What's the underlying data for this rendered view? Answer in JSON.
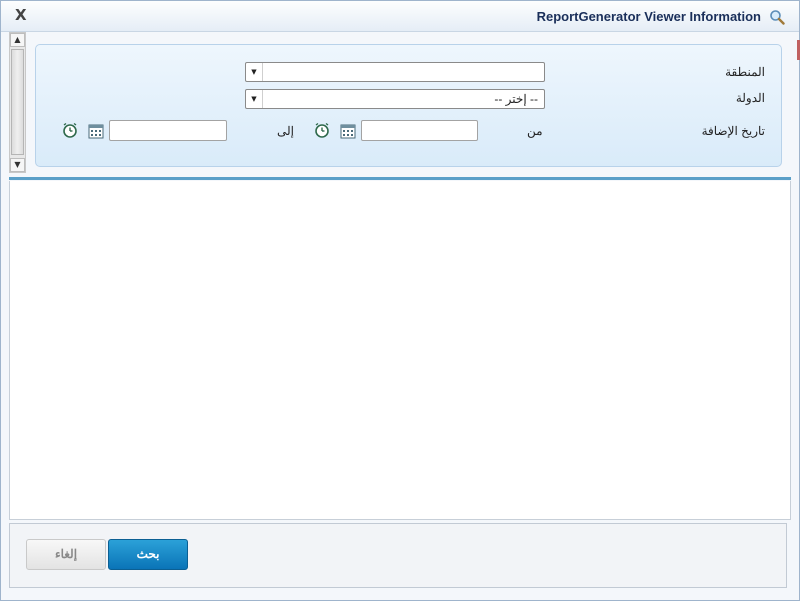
{
  "window": {
    "title": "ReportGenerator Viewer Information",
    "close_label": "X",
    "title_icon": "magnifier-icon"
  },
  "filters": {
    "region": {
      "label": "المنطقة",
      "value": ""
    },
    "country": {
      "label": "الدولة",
      "value": "-- إختر --"
    },
    "date_added": {
      "label": "تاريخ الإضافة",
      "from_label": "من",
      "to_label": "إلى",
      "from_value": "",
      "to_value": ""
    }
  },
  "footer": {
    "search_label": "بحث",
    "cancel_label": "إلغاء"
  },
  "colors": {
    "accent": "#0a74b7",
    "panel_bg": "#d9ebf9",
    "title_text": "#1a2f5a"
  }
}
